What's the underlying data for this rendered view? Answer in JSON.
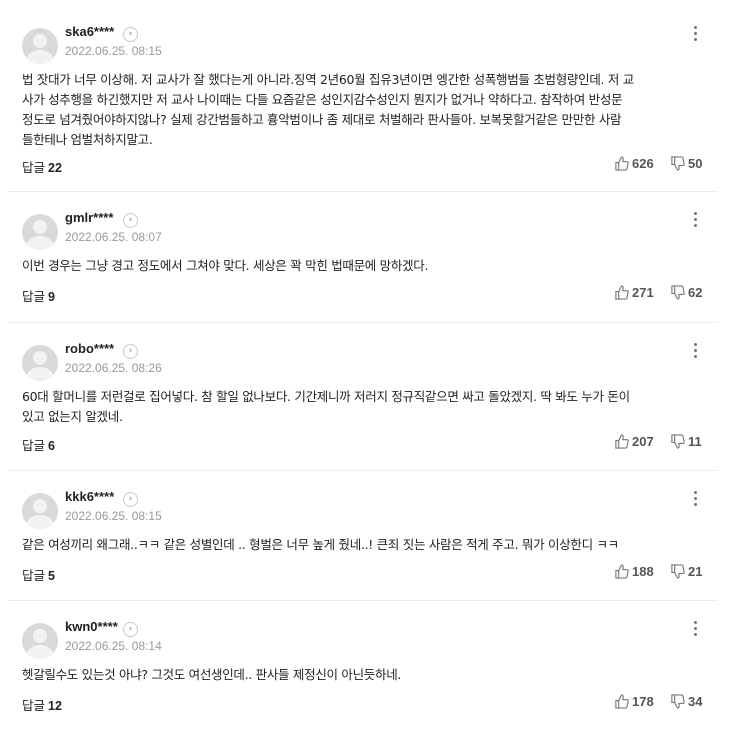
{
  "reply_label": "답글",
  "comments": [
    {
      "user": "ska6****",
      "date": "2022.06.25. 08:15",
      "lines": [
        "법 잣대가 너무 이상해. 저 교사가 잘 했다는게 아니라.징역 2년60월 집유3년이면 엥간한 성폭행범들 초범형량인데. 저 교",
        "사가 성추행을 하긴했지만 저 교사 나이때는 다들 요즘같은 성인지감수성인지 뭔지가 없거나 약하다고. 참작하여 반성문",
        "정도로 넘겨줬어야하지않나? 실제 강간범들하고 흉악범이나 좀 제대로 처벌해라 판사들아. 보복못할거같은 만만한 사람",
        "들한테나 엄벌처하지말고."
      ],
      "replies": "22",
      "likes": "626",
      "dislikes": "50"
    },
    {
      "user": "gmlr****",
      "date": "2022.06.25. 08:07",
      "lines": [
        "이번 경우는 그냥 경고 정도에서 그쳐야 맞다. 세상은 꽉 막힌 법때문에 망하겠다."
      ],
      "replies": "9",
      "likes": "271",
      "dislikes": "62"
    },
    {
      "user": "robo****",
      "date": "2022.06.25. 08:26",
      "lines": [
        "60대 할머니를 저런걸로 집어넣다. 참 할일 없나보다. 기간제니까 저러지 정규직같으면 싸고 돌았겠지. 딱 봐도 누가 돈이",
        "있고 없는지 알겠네."
      ],
      "replies": "6",
      "likes": "207",
      "dislikes": "11"
    },
    {
      "user": "kkk6****",
      "date": "2022.06.25. 08:15",
      "lines": [
        "같은 여성끼리 왜그래..ㅋㅋ 같은 성별인데 .. 형벌은 너무 높게 줬네..! 큰죄 짓는 사람은 적게 주고. 뭐가 이상한디 ㅋㅋ"
      ],
      "replies": "5",
      "likes": "188",
      "dislikes": "21"
    },
    {
      "user": "kwn0****",
      "date": "2022.06.25. 08:14",
      "lines": [
        "헷갈릴수도 있는것 아냐? 그것도 여선생인데.. 판사들 제정신이 아닌듯하네."
      ],
      "replies": "12",
      "likes": "178",
      "dislikes": "34"
    }
  ]
}
